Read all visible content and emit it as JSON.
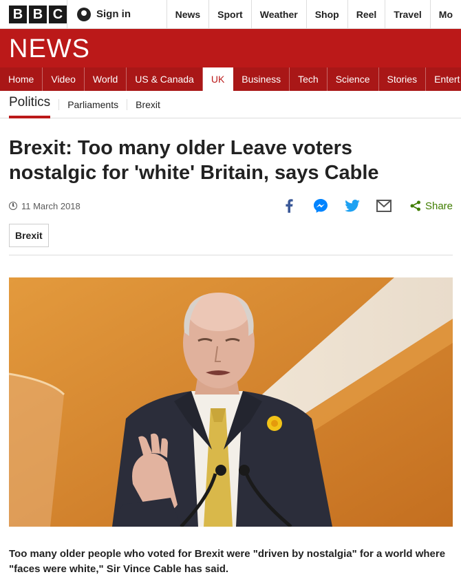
{
  "topbar": {
    "logo_letters": [
      "B",
      "B",
      "C"
    ],
    "signin_label": "Sign in",
    "nav": [
      "News",
      "Sport",
      "Weather",
      "Shop",
      "Reel",
      "Travel",
      "Mo"
    ]
  },
  "brand": {
    "title": "NEWS",
    "color": "#bb1919"
  },
  "sections": [
    "Home",
    "Video",
    "World",
    "US & Canada",
    "UK",
    "Business",
    "Tech",
    "Science",
    "Stories",
    "Entert"
  ],
  "active_section": "UK",
  "subnav": {
    "primary": "Politics",
    "links": [
      "Parliaments",
      "Brexit"
    ]
  },
  "article": {
    "headline": "Brexit: Too many older Leave voters nostalgic for 'white' Britain, says Cable",
    "date": "11 March 2018",
    "share_label": "Share",
    "tag": "Brexit",
    "summary": "Too many older people who voted for Brexit were \"driven by nostalgia\" for a world where \"faces were white,\" Sir Vince Cable has said."
  },
  "share_icons": [
    "facebook-icon",
    "messenger-icon",
    "twitter-icon",
    "email-icon",
    "share-icon"
  ],
  "colors": {
    "share_green": "#407d00",
    "facebook": "#3b5998",
    "messenger": "#0084ff",
    "twitter": "#1da1f2"
  }
}
